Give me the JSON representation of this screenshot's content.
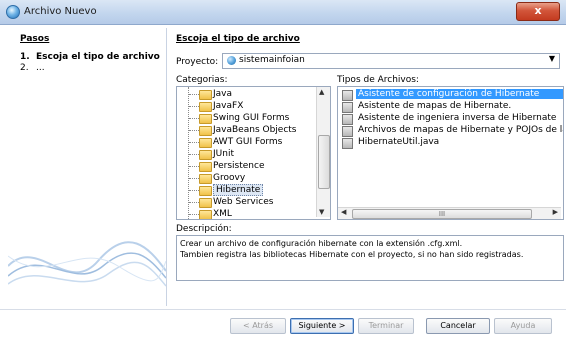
{
  "window": {
    "title": "Archivo Nuevo",
    "close_label": "x"
  },
  "left": {
    "title": "Pasos",
    "steps": [
      {
        "num": "1.",
        "label": "Escoja el tipo de archivo"
      },
      {
        "num": "2.",
        "label": "..."
      }
    ]
  },
  "main": {
    "section_title": "Escoja el tipo de archivo",
    "project_label": "Proyecto:",
    "project_value": "sistemainfoian",
    "categories_label": "Categorias:",
    "types_label": "Tipos de Archivos:",
    "categories": [
      "Java",
      "JavaFX",
      "Swing GUI Forms",
      "JavaBeans Objects",
      "AWT GUI Forms",
      "JUnit",
      "Persistence",
      "Groovy",
      "Hibernate",
      "Web Services",
      "XML"
    ],
    "selected_category": "Hibernate",
    "file_types": [
      "Asistente de configuración de Hibernate",
      "Asistente de mapas de Hibernate.",
      "Asistente de ingeniera inversa de Hibernate",
      "Archivos de mapas de Hibernate y POJOs de la base de",
      "HibernateUtil.java"
    ],
    "selected_file_type": "Asistente de configuración de Hibernate",
    "hscroll_label": "III",
    "description_label": "Descripción:",
    "description_text": "Crear un archivo de configuración hibernate con la extensión .cfg.xml.\nTambien registra las bibliotecas Hibernate con el proyecto, si no han sido registradas."
  },
  "buttons": {
    "back": "< Atrás",
    "next": "Siguiente >",
    "finish": "Terminar",
    "cancel": "Cancelar",
    "help": "Ayuda"
  },
  "colors": {
    "selection": "#3399ff",
    "titlebar": "#c3d6ee"
  }
}
